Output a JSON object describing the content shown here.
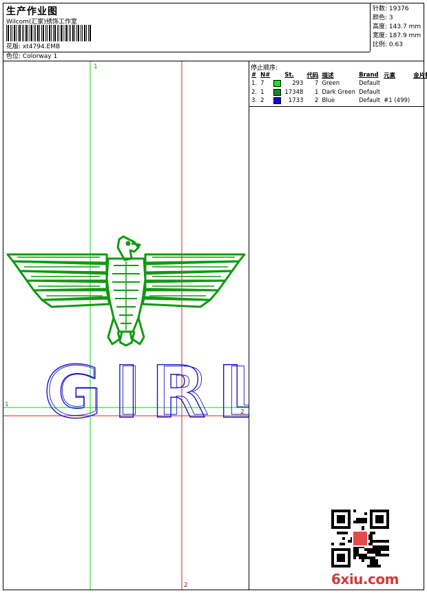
{
  "header": {
    "title": "生产作业图",
    "studio": "Wilcom(汇家)绣饰工作室",
    "design_label": "花版:",
    "design_file": "xt4794.EMB",
    "colorway_label": "色位:",
    "colorway": "Colorway 1"
  },
  "stats": {
    "stitches_label": "针数:",
    "stitches": "19376",
    "colors_label": "颜色:",
    "colors": "3",
    "height_label": "高度:",
    "height": "143.7 mm",
    "width_label": "宽度:",
    "width": "187.9 mm",
    "scale_label": "比例:",
    "scale": "0.63"
  },
  "sequence": {
    "title": "停止顺序:",
    "columns": [
      "#",
      "N#",
      "St.",
      "代码",
      "描述",
      "Brand",
      "元素",
      "金片数"
    ],
    "rows": [
      {
        "idx": "1.",
        "n": "7",
        "color": "#19e619",
        "st": "293",
        "code": "7",
        "desc": "Green",
        "brand": "Default",
        "elem": "",
        "sequins": ""
      },
      {
        "idx": "2.",
        "n": "1",
        "color": "#128a12",
        "st": "17348",
        "code": "1",
        "desc": "Dark Green",
        "brand": "Default",
        "elem": "",
        "sequins": ""
      },
      {
        "idx": "3.",
        "n": "2",
        "color": "#0a0ae6",
        "st": "1733",
        "code": "2",
        "desc": "Blue",
        "brand": "Default",
        "elem": "#1 (499)",
        "sequins": ""
      }
    ]
  },
  "design": {
    "text": "GIRL",
    "eagle_color": "#0f9a0f",
    "text_color": "#1414c8"
  },
  "guides": {
    "green_vertical": "1",
    "green_horizontal": "1",
    "red_horizontal": "2",
    "red_vertical": "2",
    "green_color": "#19d219",
    "red_color": "#dc1e1e"
  },
  "watermark": {
    "text": "6xiu.com"
  }
}
